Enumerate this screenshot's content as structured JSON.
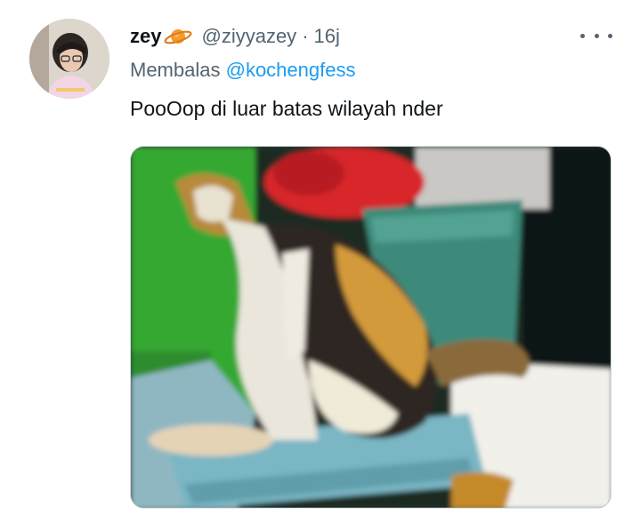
{
  "tweet": {
    "author": {
      "name": "zey",
      "name_emoji": "planet-emoji",
      "handle": "@ziyyazey",
      "separator": "·",
      "time": "16j"
    },
    "reply": {
      "label": "Membalas",
      "mention": "@kochengfess"
    },
    "text": "PooOop di luar batas wilayah nder",
    "media": {
      "description_icon": "cat-photo",
      "colors": {
        "green_wall": "#34a832",
        "teal_basket": "#3c8a7a",
        "red_cloth": "#d8262a",
        "blue_tray": "#7ab6c4"
      }
    },
    "more_icon": "more-options-icon"
  }
}
